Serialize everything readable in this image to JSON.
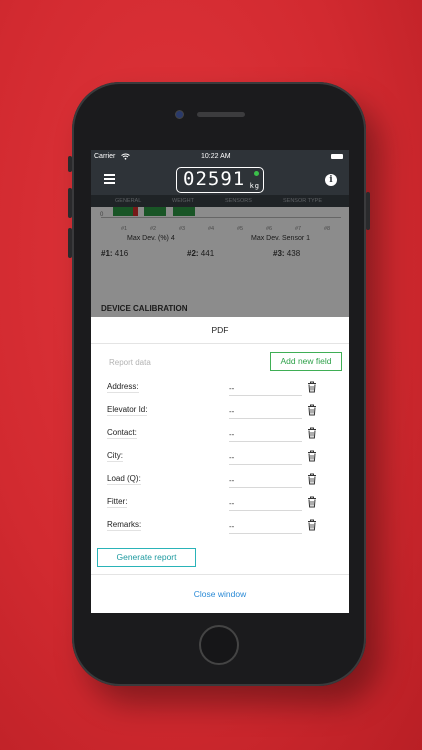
{
  "status": {
    "carrier": "Carrier",
    "time": "10:22 AM"
  },
  "header": {
    "display_value": "02591",
    "unit": "kg"
  },
  "tabs": [
    "GENERAL",
    "WEIGHT",
    "SENSORS",
    "SENSOR TYPE"
  ],
  "background": {
    "axis_zero": "0",
    "axis_numbers": [
      "#1",
      "#2",
      "#3",
      "#4",
      "#5",
      "#6",
      "#7",
      "#8"
    ],
    "max_dev_pct": "Max Dev. (%) 4",
    "max_dev_sensor": "Max Dev. Sensor 1",
    "sensors": [
      {
        "label": "#1:",
        "value": "416"
      },
      {
        "label": "#2:",
        "value": "441"
      },
      {
        "label": "#3:",
        "value": "438"
      }
    ],
    "section_title": "DEVICE CALIBRATION"
  },
  "modal": {
    "title": "PDF",
    "report_data_placeholder": "Report data",
    "add_field_label": "Add new field",
    "fields": [
      {
        "label": "Address:",
        "value": "--"
      },
      {
        "label": "Elevator Id:",
        "value": "--"
      },
      {
        "label": "Contact:",
        "value": "--"
      },
      {
        "label": "City:",
        "value": "--"
      },
      {
        "label": "Load (Q):",
        "value": "--"
      },
      {
        "label": "Fitter:",
        "value": "--"
      },
      {
        "label": "Remarks:",
        "value": "--"
      }
    ],
    "generate_label": "Generate report",
    "close_label": "Close window"
  },
  "colors": {
    "background": "#d22a30",
    "header": "#2e3338",
    "add_button": "#2fa14a",
    "generate_button": "#1e9aa0",
    "close_link": "#2a8ad6",
    "status_dot": "#3bbf4a"
  }
}
